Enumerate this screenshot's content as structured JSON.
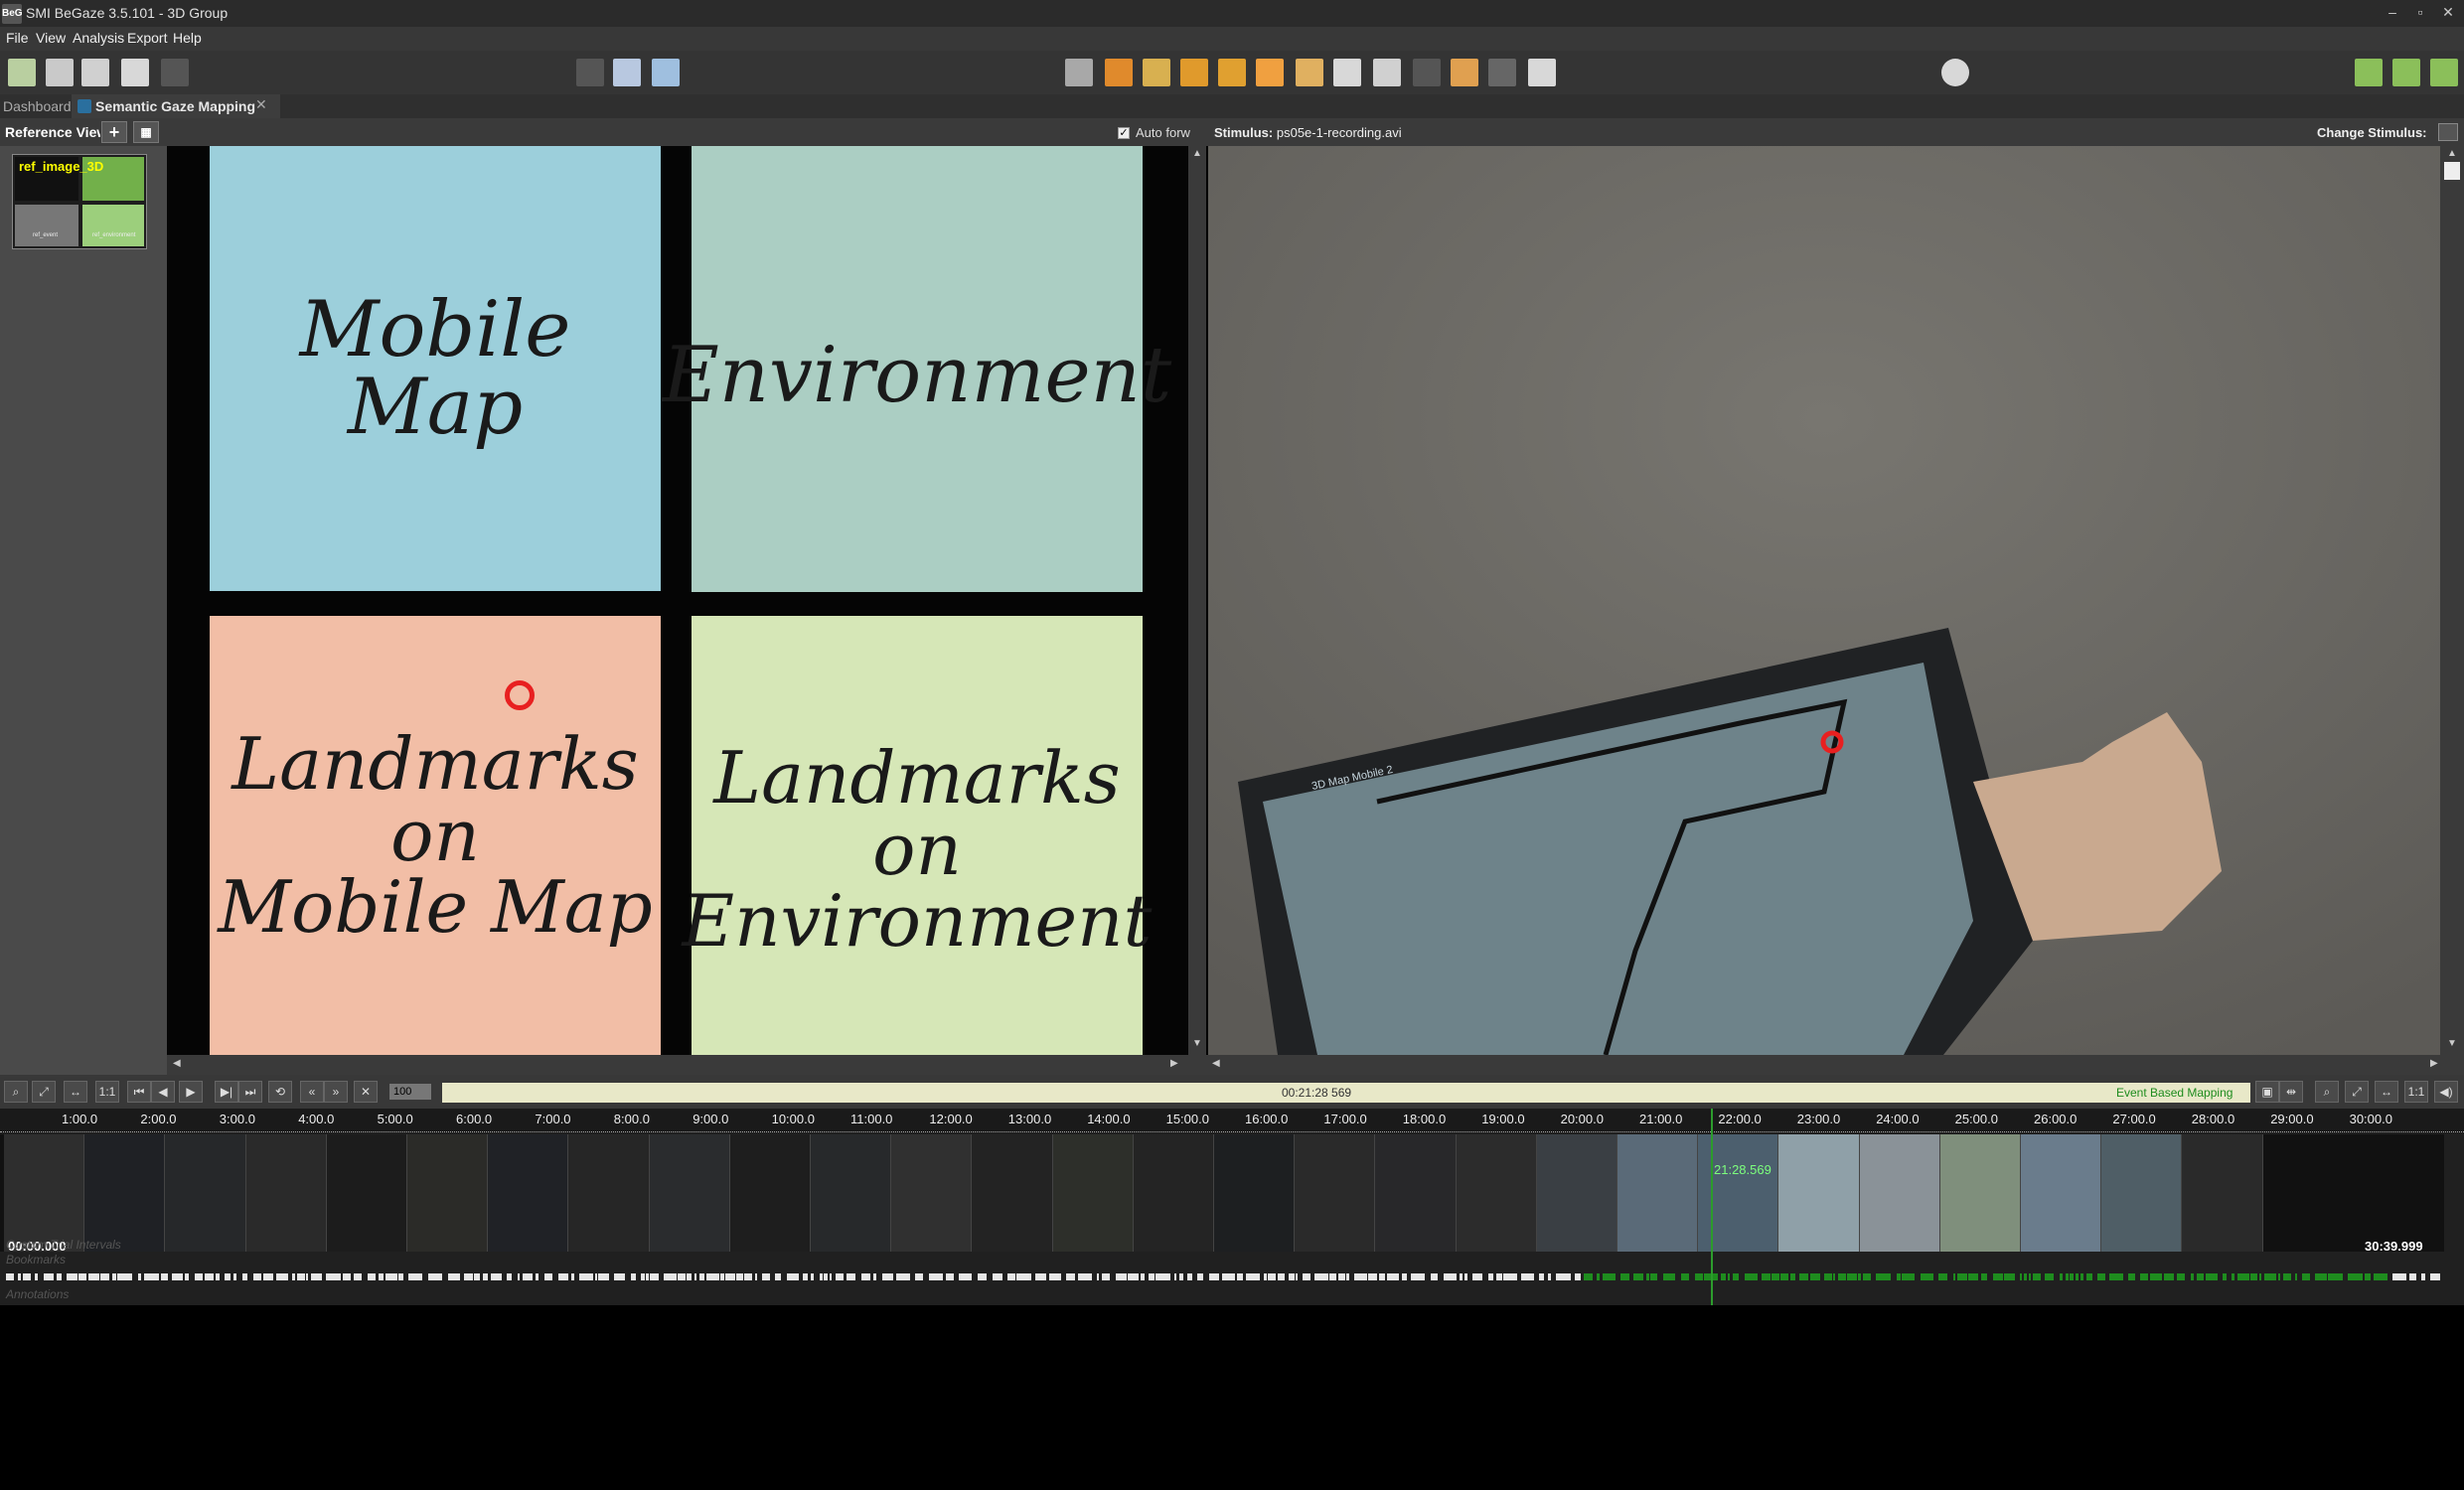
{
  "window": {
    "title": "SMI BeGaze 3.5.101 - 3D Group",
    "icon_text": "BeG",
    "min": "–",
    "max": "▫",
    "close": "✕"
  },
  "menu": [
    "File",
    "View",
    "Analysis",
    "Export",
    "Help"
  ],
  "tabs": {
    "dashboard": "Dashboard",
    "active": "Semantic Gaze Mapping",
    "close": "✕"
  },
  "reference_view": {
    "label": "Reference View",
    "add": "+",
    "thumbnail_label": "ref_image_3D",
    "thumb_caption_left": "ref_event",
    "thumb_caption_right": "ref_environment"
  },
  "auto_forward": {
    "label": "Auto forw",
    "checked": "✓"
  },
  "quadrants": {
    "mobile_map": "Mobile Map",
    "environment": "Environment",
    "landmarks_map_1": "Landmarks on",
    "landmarks_map_2": "Mobile Map",
    "landmarks_env_1": "Landmarks on",
    "landmarks_env_2": "Environment"
  },
  "stimulus": {
    "label": "Stimulus:",
    "file": "ps05e-1-recording.avi",
    "change": "Change Stimulus:"
  },
  "tablet_title": "3D Map Mobile 2",
  "playback": {
    "zoom": "100",
    "current_time": "00:21:28 569",
    "mode": "Event Based Mapping"
  },
  "timeline": {
    "ticks": [
      "1:00.0",
      "2:00.0",
      "3:00.0",
      "4:00.0",
      "5:00.0",
      "6:00.0",
      "7:00.0",
      "8:00.0",
      "9:00.0",
      "10:00.0",
      "11:00.0",
      "12:00.0",
      "13:00.0",
      "14:00.0",
      "15:00.0",
      "16:00.0",
      "17:00.0",
      "18:00.0",
      "19:00.0",
      "20:00.0",
      "21:00.0",
      "22:00.0",
      "23:00.0",
      "24:00.0",
      "25:00.0",
      "26:00.0",
      "27:00.0",
      "28:00.0",
      "29:00.0",
      "30:00.0"
    ],
    "start": "00:00.000",
    "end": "30:39.999",
    "cursor": "21:28.569",
    "tracks": [
      "Custom Trial Intervals",
      "Bookmarks",
      "",
      "Annotations"
    ]
  },
  "colors": {
    "mobile_map": "#9ccfdb",
    "environment": "#abcec3",
    "landmarks_map": "#f2bea6",
    "landmarks_env": "#d6e7b7",
    "gaze": "#e82020",
    "accent_green": "#1e8c1e"
  }
}
